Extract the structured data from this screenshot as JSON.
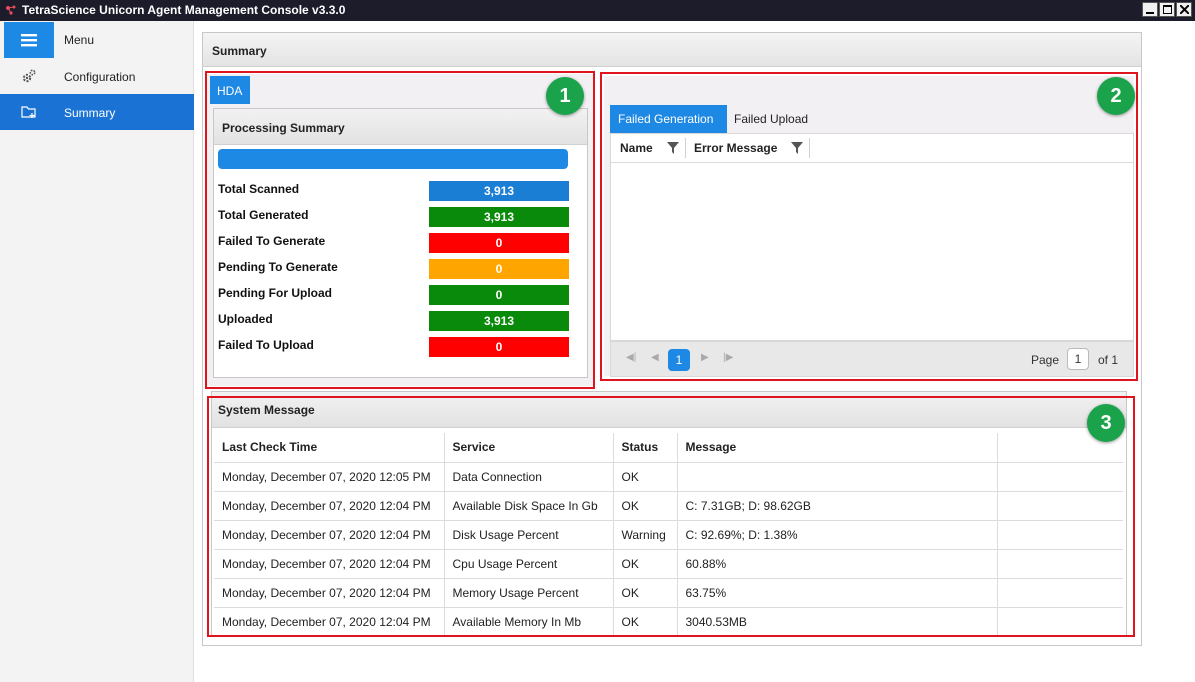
{
  "window": {
    "title": "TetraScience Unicorn Agent Management Console v3.3.0"
  },
  "sidebar": {
    "items": [
      {
        "label": "Menu",
        "icon": "hamburger-icon"
      },
      {
        "label": "Configuration",
        "icon": "gears-icon"
      },
      {
        "label": "Summary",
        "icon": "folder-add-icon",
        "selected": true
      }
    ]
  },
  "main": {
    "title": "Summary"
  },
  "annotations": [
    "1",
    "2",
    "3"
  ],
  "hda": {
    "tab_label": "HDA",
    "processing": {
      "title": "Processing Summary",
      "progress_fraction": 1.0,
      "stats": [
        {
          "label": "Total Scanned",
          "value": "3,913",
          "color": "#1a7fd4"
        },
        {
          "label": "Total Generated",
          "value": "3,913",
          "color": "#0a8a0a"
        },
        {
          "label": "Failed To Generate",
          "value": "0",
          "color": "#ff0000"
        },
        {
          "label": "Pending To Generate",
          "value": "0",
          "color": "#ffa500"
        },
        {
          "label": "Pending For Upload",
          "value": "0",
          "color": "#0a8a0a"
        },
        {
          "label": "Uploaded",
          "value": "3,913",
          "color": "#0a8a0a"
        },
        {
          "label": "Failed To Upload",
          "value": "0",
          "color": "#ff0000"
        }
      ]
    }
  },
  "failures": {
    "tabs": [
      {
        "label": "Failed Generation",
        "active": true
      },
      {
        "label": "Failed Upload",
        "active": false
      }
    ],
    "columns": [
      "Name",
      "Error Message"
    ],
    "pager": {
      "current_page": "1",
      "page_label": "Page",
      "page_input": "1",
      "of_label": "of 1"
    }
  },
  "system_message": {
    "title": "System Message",
    "columns": [
      "Last Check Time",
      "Service",
      "Status",
      "Message"
    ],
    "rows": [
      [
        "Monday, December 07, 2020 12:05 PM",
        "Data Connection",
        "OK",
        ""
      ],
      [
        "Monday, December 07, 2020 12:04 PM",
        "Available Disk Space In Gb",
        "OK",
        "C: 7.31GB; D: 98.62GB"
      ],
      [
        "Monday, December 07, 2020 12:04 PM",
        "Disk Usage Percent",
        "Warning",
        "C: 92.69%; D: 1.38%"
      ],
      [
        "Monday, December 07, 2020 12:04 PM",
        "Cpu Usage Percent",
        "OK",
        "60.88%"
      ],
      [
        "Monday, December 07, 2020 12:04 PM",
        "Memory Usage Percent",
        "OK",
        "63.75%"
      ],
      [
        "Monday, December 07, 2020 12:04 PM",
        "Available Memory In Mb",
        "OK",
        "3040.53MB"
      ]
    ]
  }
}
